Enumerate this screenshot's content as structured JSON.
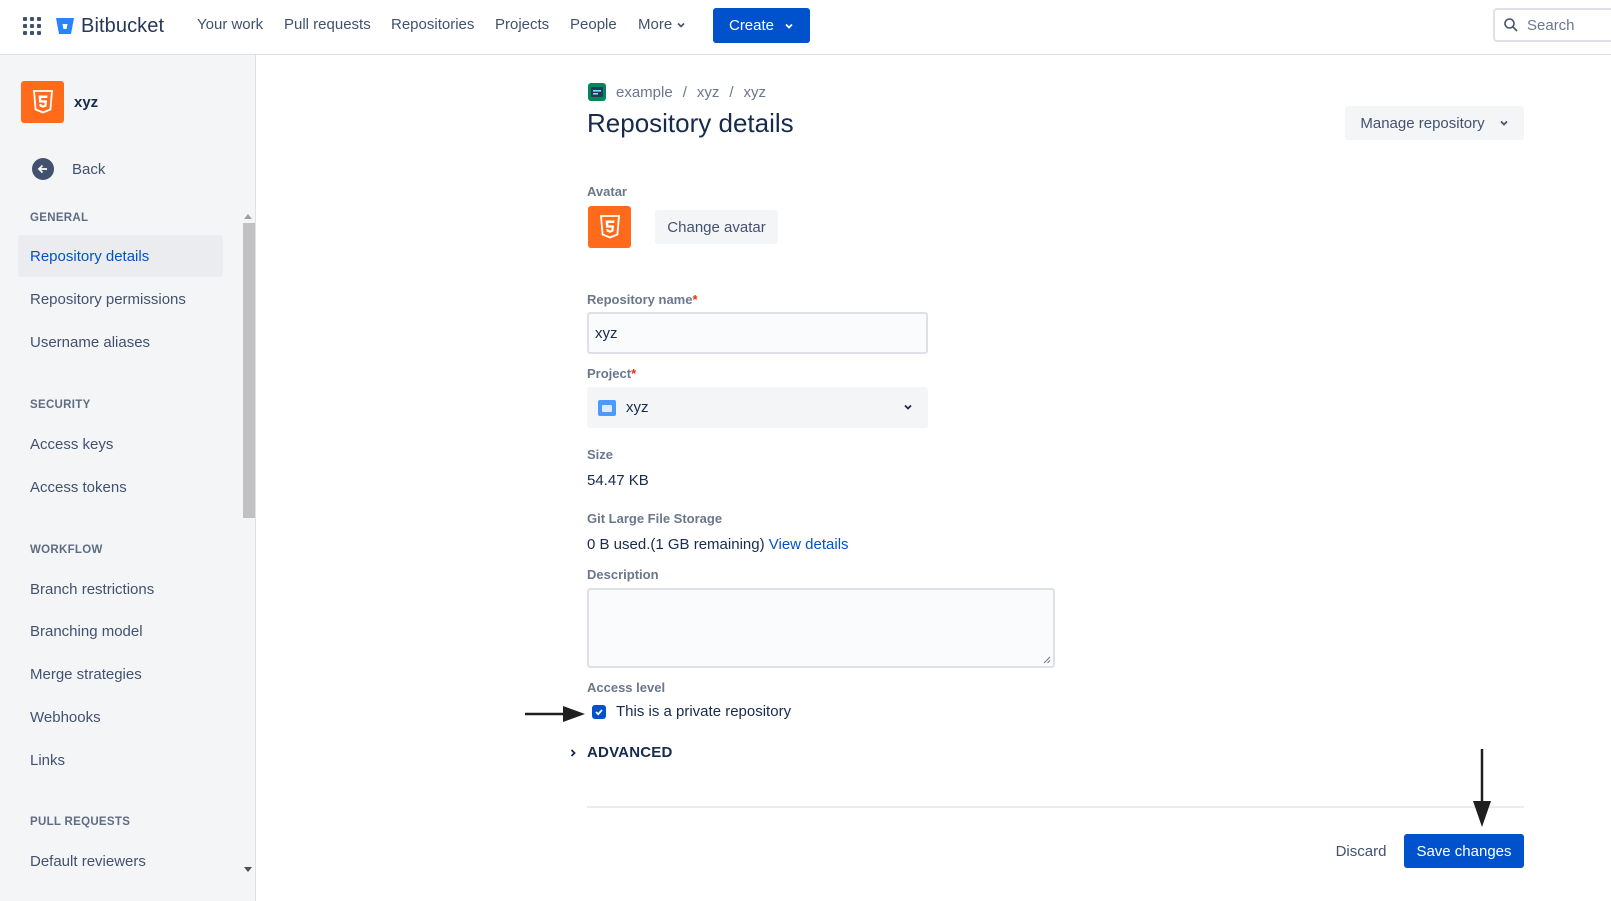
{
  "topnav": {
    "brand": "Bitbucket",
    "items": [
      "Your work",
      "Pull requests",
      "Repositories",
      "Projects",
      "People"
    ],
    "more_label": "More",
    "create_label": "Create",
    "search_placeholder": "Search"
  },
  "sidebar": {
    "repo_name": "xyz",
    "back_label": "Back",
    "sections": {
      "general": "GENERAL",
      "security": "SECURITY",
      "workflow": "WORKFLOW",
      "pull_requests": "PULL REQUESTS"
    },
    "general_items": [
      "Repository details",
      "Repository permissions",
      "Username aliases"
    ],
    "security_items": [
      "Access keys",
      "Access tokens"
    ],
    "workflow_items": [
      "Branch restrictions",
      "Branching model",
      "Merge strategies",
      "Webhooks",
      "Links"
    ],
    "pull_request_items": [
      "Default reviewers"
    ]
  },
  "main": {
    "breadcrumb": [
      "example",
      "xyz",
      "xyz"
    ],
    "breadcrumb_separator": "/",
    "title": "Repository details",
    "manage_label": "Manage repository",
    "avatar_label": "Avatar",
    "change_avatar_label": "Change avatar",
    "repo_name_label": "Repository name",
    "repo_name_value": "xyz",
    "required_mark": "*",
    "project_label": "Project",
    "project_value": "xyz",
    "size_label": "Size",
    "size_value": "54.47 KB",
    "lfs_label": "Git Large File Storage",
    "lfs_value": "0 B used.(1 GB remaining)",
    "lfs_link": "View details",
    "description_label": "Description",
    "description_value": "",
    "access_label": "Access level",
    "private_label": "This is a private repository",
    "private_checked": true,
    "advanced_label": "ADVANCED",
    "discard_label": "Discard",
    "save_label": "Save changes"
  },
  "colors": {
    "primary": "#0052cc",
    "repo_avatar": "#ff6b1a",
    "required": "#de350b"
  }
}
